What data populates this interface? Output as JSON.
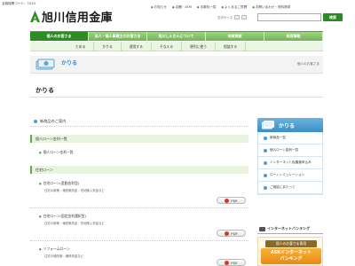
{
  "header": {
    "bank_code": "金融機関コード：1020",
    "logo_name": "旭川信用金庫",
    "toplinks": [
      "お知らせ",
      "店舗・ATM",
      "手数料一覧",
      "よくあるご質問",
      "お問い合わせ・資料請求"
    ],
    "fontsize_label": "文字サイズ",
    "search_placeholder": "",
    "search_button": "検索"
  },
  "nav_primary": [
    "個人のお客さま",
    "法人・個人事業主のお客さま",
    "旭川しんきんについて",
    "地域貢献",
    "採用情報"
  ],
  "nav_secondary": [
    "ためる",
    "かりる",
    "運用する",
    "そなえる",
    "便利に使う",
    "相談する"
  ],
  "banner": {
    "title": "かりる",
    "breadcrumb": "個人のお客さま"
  },
  "page_title": "かりる",
  "main": {
    "section_title": "新商品のご案内",
    "group1": {
      "header": "個人ローン金利一覧",
      "link": "個人ローン金利一覧"
    },
    "group2": {
      "header": "住宅ローン",
      "items": [
        {
          "title": "住宅ローン(変動金利型)",
          "desc": "住宅の新築・増改築資金・宅地購入資金など",
          "pdf": "PDF"
        },
        {
          "title": "住宅ローン(固定金利選択型)",
          "desc": "住宅の新築・増改築資金・宅地購入資金など",
          "pdf": "PDF"
        },
        {
          "title": "リフォームローン",
          "desc": "住宅の増改築・補修資金など",
          "pdf": "PDF"
        }
      ]
    }
  },
  "sidebar": {
    "title": "かりる",
    "items": [
      "新商品一覧",
      "個人ローン金利一覧",
      "インターネット仮審査申込み",
      "ローンシミュレーション",
      "ご相談にあたって"
    ]
  },
  "internet_banking": {
    "title": "インターネットバンキング",
    "sub": "個人のお客さま専用",
    "button_line1": "ASKインターネット",
    "button_line2": "バンキング"
  },
  "colors": {
    "brand_green": "#2f8c24",
    "accent_blue": "#3a8fc4",
    "pdf_red": "#d9362b"
  }
}
